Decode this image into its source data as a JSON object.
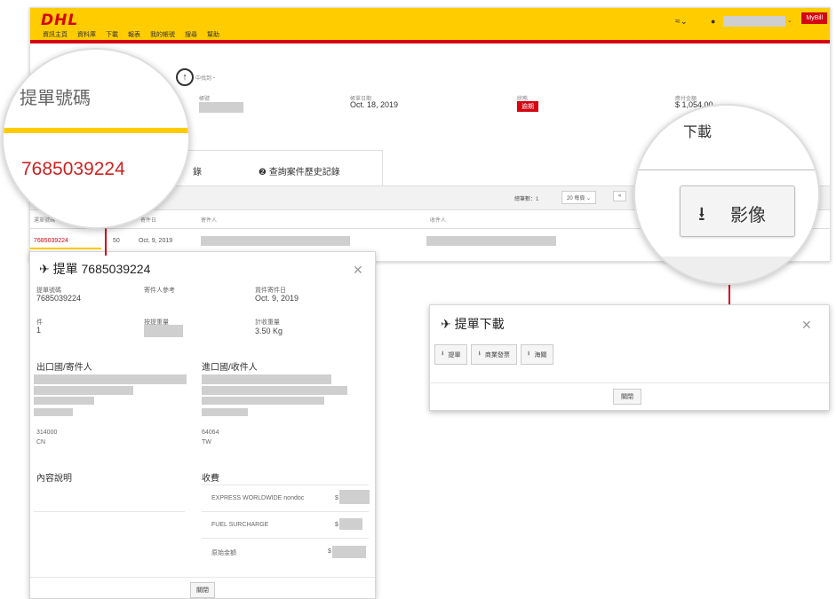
{
  "header": {
    "logo": "DHL",
    "nav": [
      "資訊主頁",
      "資料庫",
      "下載",
      "報表",
      "我的帳號",
      "搜尋",
      "幫助"
    ],
    "mybill": "MyBill"
  },
  "page": {
    "breadcrumb": "中找到・",
    "cols": [
      {
        "label": "帳單日期",
        "value": "Oct. 18, 2019"
      },
      {
        "label": "狀態",
        "value": "逾期"
      },
      {
        "label": "應付金額",
        "value": "$ 1,054.00"
      }
    ],
    "label_account": "帳號",
    "tab_history": "查詢案件歷史記錄",
    "tab_partial": "錄",
    "pager_count": "總筆數：1",
    "pager_per_page": "20 每頁",
    "table_headers": [
      "運單號碼",
      "寄件日",
      "寄件人",
      "收件人"
    ],
    "row": {
      "awb": "7685039224",
      "partial": "50",
      "date": "Oct. 9, 2019"
    }
  },
  "airbill": {
    "title": "提單 7685039224",
    "fields": [
      {
        "label": "提單號碼",
        "value": "7685039224"
      },
      {
        "label": "寄件人參考",
        "value": ""
      },
      {
        "label": "貨件寄件日",
        "value": "Oct. 9, 2019"
      },
      {
        "label": "件",
        "value": "1"
      },
      {
        "label": "按提重量",
        "value": ""
      },
      {
        "label": "計收重量",
        "value": "3.50 Kg"
      }
    ],
    "shipper_heading": "出口國/寄件人",
    "consignee_heading": "進口國/收件人",
    "shipper_zip": "314000",
    "shipper_country": "CN",
    "consignee_zip": "64064",
    "consignee_country": "TW",
    "contents_heading": "內容說明",
    "charges_heading": "收費",
    "charges": [
      {
        "name": "EXPRESS WORLDWIDE nondoc",
        "currency": "$"
      },
      {
        "name": "FUEL SURCHARGE",
        "currency": "$"
      },
      {
        "name": "原始金額",
        "currency": "$"
      }
    ],
    "close_button": "關閉"
  },
  "download": {
    "title": "提單下載",
    "buttons": [
      "提單",
      "商業發票",
      "海關"
    ],
    "close_button": "關閉"
  },
  "zoom_left": {
    "label": "提單號碼",
    "value": "7685039224"
  },
  "zoom_right": {
    "label": "下載",
    "button": "影像"
  }
}
